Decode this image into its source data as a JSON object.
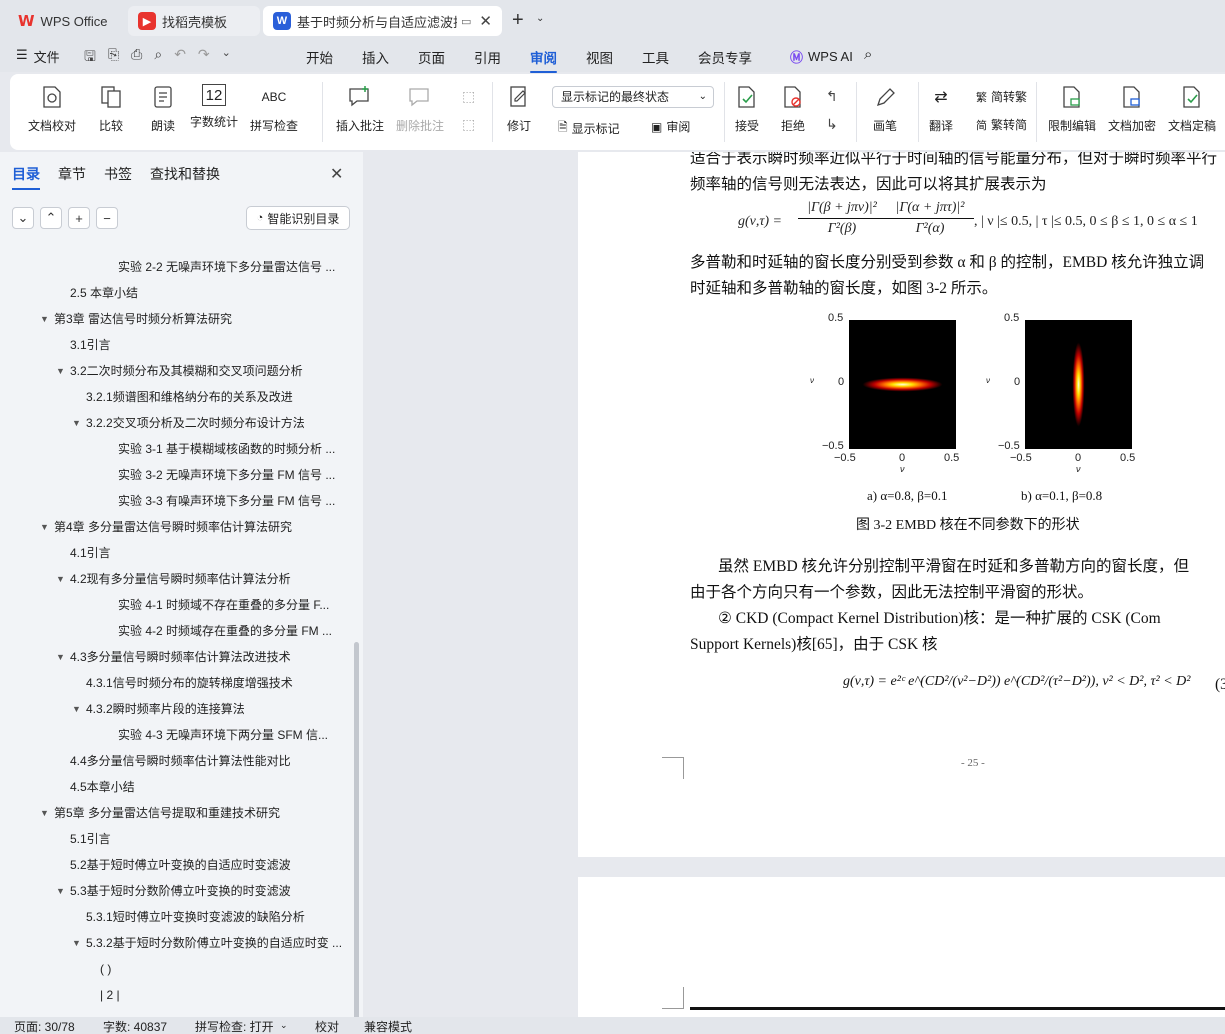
{
  "tabs": [
    {
      "label": "WPS Office"
    },
    {
      "label": "找稻壳模板"
    },
    {
      "label": "基于时频分析与自适应滤波技"
    }
  ],
  "menu": {
    "file": "文件",
    "items": [
      "开始",
      "插入",
      "页面",
      "引用",
      "审阅",
      "视图",
      "工具",
      "会员专享"
    ],
    "ai": "WPS AI"
  },
  "ribbon": {
    "doc_check": "文档校对",
    "compare": "比较",
    "read_aloud": "朗读",
    "word_count": "字数统计",
    "spell_check": "拼写检查",
    "insert_comment": "插入批注",
    "delete_comment": "删除批注",
    "revise": "修订",
    "show_mode": "显示标记的最终状态",
    "show_marks": "显示标记",
    "review": "审阅",
    "accept": "接受",
    "reject": "拒绝",
    "pen": "画笔",
    "translate": "翻译",
    "to_traditional": "简转繁",
    "to_simplified": "繁转简",
    "restrict_edit": "限制编辑",
    "encrypt": "文档加密",
    "finalize": "文档定稿",
    "wc_icon_text": "12",
    "spell_icon_text": "ABC"
  },
  "panel": {
    "tabs": [
      "目录",
      "章节",
      "书签",
      "查找和替换"
    ],
    "smart_button": "智能识别目录",
    "toc": [
      {
        "text": "实验 2-2 无噪声环境下多分量雷达信号 ...",
        "level": 4,
        "arrow": ""
      },
      {
        "text": "2.5 本章小结",
        "level": 2,
        "arrow": ""
      },
      {
        "text": "第3章 雷达信号时频分析算法研究",
        "level": 1,
        "arrow": "▼"
      },
      {
        "text": "3.1引言",
        "level": 2,
        "arrow": ""
      },
      {
        "text": "3.2二次时频分布及其模糊和交叉项问题分析",
        "level": 2,
        "arrow": "▼"
      },
      {
        "text": "3.2.1频谱图和维格纳分布的关系及改进",
        "level": 3,
        "arrow": ""
      },
      {
        "text": "3.2.2交叉项分析及二次时频分布设计方法",
        "level": 3,
        "arrow": "▼"
      },
      {
        "text": "实验 3-1 基于模糊域核函数的时频分析 ...",
        "level": 4,
        "arrow": ""
      },
      {
        "text": "实验 3-2 无噪声环境下多分量 FM 信号 ...",
        "level": 4,
        "arrow": ""
      },
      {
        "text": "实验 3-3 有噪声环境下多分量 FM 信号 ...",
        "level": 4,
        "arrow": ""
      },
      {
        "text": "第4章 多分量雷达信号瞬时频率估计算法研究",
        "level": 1,
        "arrow": "▼"
      },
      {
        "text": "4.1引言",
        "level": 2,
        "arrow": ""
      },
      {
        "text": "4.2现有多分量信号瞬时频率估计算法分析",
        "level": 2,
        "arrow": "▼"
      },
      {
        "text": "实验 4-1 时频域不存在重叠的多分量 F...",
        "level": 4,
        "arrow": ""
      },
      {
        "text": "实验 4-2 时频域存在重叠的多分量 FM ...",
        "level": 4,
        "arrow": ""
      },
      {
        "text": "4.3多分量信号瞬时频率估计算法改进技术",
        "level": 2,
        "arrow": "▼"
      },
      {
        "text": "4.3.1信号时频分布的旋转梯度增强技术",
        "level": 3,
        "arrow": ""
      },
      {
        "text": "4.3.2瞬时频率片段的连接算法",
        "level": 3,
        "arrow": "▼"
      },
      {
        "text": "实验 4-3 无噪声环境下两分量 SFM 信...",
        "level": 4,
        "arrow": ""
      },
      {
        "text": "4.4多分量信号瞬时频率估计算法性能对比",
        "level": 2,
        "arrow": ""
      },
      {
        "text": "4.5本章小结",
        "level": 2,
        "arrow": ""
      },
      {
        "text": "第5章 多分量雷达信号提取和重建技术研究",
        "level": 1,
        "arrow": "▼"
      },
      {
        "text": "5.1引言",
        "level": 2,
        "arrow": ""
      },
      {
        "text": "5.2基于短时傅立叶变换的自适应时变滤波",
        "level": 2,
        "arrow": ""
      },
      {
        "text": "5.3基于短时分数阶傅立叶变换的时变滤波",
        "level": 2,
        "arrow": "▼"
      },
      {
        "text": "5.3.1短时傅立叶变换时变滤波的缺陷分析",
        "level": 3,
        "arrow": ""
      },
      {
        "text": "5.3.2基于短时分数阶傅立叶变换的自适应时变 ...",
        "level": 3,
        "arrow": "▼"
      },
      {
        "text": "( )",
        "level": 5,
        "arrow": ""
      },
      {
        "text": "| 2 |",
        "level": 5,
        "arrow": ""
      }
    ]
  },
  "document": {
    "line1": "适合于表示瞬时频率近似平行于时间轴的信号能量分布，但对于瞬时频率平行",
    "line2": "频率轴的信号则无法表达，因此可以将其扩展表示为",
    "line3": "多普勒和时延轴的窗长度分别受到参数 α 和 β 的控制，EMBD 核允许独立调",
    "line4": "时延轴和多普勒轴的窗长度，如图 3-2 所示。",
    "sub_a": "a) α=0.8, β=0.1",
    "sub_b": "b) α=0.1, β=0.8",
    "fig_caption": "图 3-2 EMBD 核在不同参数下的形状",
    "para1": "虽然 EMBD 核允许分别控制平滑窗在时延和多普勒方向的窗长度，但",
    "para2": "由于各个方向只有一个参数，因此无法控制平滑窗的形状。",
    "para3": "② CKD (Compact Kernel Distribution)核：是一种扩展的 CSK (Com",
    "para4": "Support Kernels)核[65]，由于 CSK 核",
    "page_number": "- 25 -",
    "formula_num": "(3",
    "eq1_lhs": "g(ν,τ) =",
    "eq1_num1": "|Γ(β + jπν)|²",
    "eq1_den1": "Γ²(β)",
    "eq1_num2": "|Γ(α + jπτ)|²",
    "eq1_den2": "Γ²(α)",
    "eq1_cond": ", | ν |≤ 0.5, | τ |≤ 0.5, 0 ≤ β ≤ 1, 0 ≤ α ≤ 1",
    "eq2": "g(ν,τ) = e²ᶜ e^(CD²/(ν²−D²)) e^(CD²/(τ²−D²)), ν² < D², τ² < D²",
    "plot_axis": {
      "y_ticks": [
        "0.5",
        "0",
        "−0.5"
      ],
      "x_ticks": [
        "−0.5",
        "0",
        "0.5"
      ],
      "xlabel": "ν",
      "ylabel": "ν"
    }
  },
  "status": {
    "page": "页面: 30/78",
    "words": "字数: 40837",
    "spell": "拼写检查: 打开",
    "proof": "校对",
    "compat": "兼容模式"
  },
  "colors": {
    "accent": "#1f5fd6",
    "wps_red": "#e8332e",
    "word_blue": "#2a5fd9"
  }
}
